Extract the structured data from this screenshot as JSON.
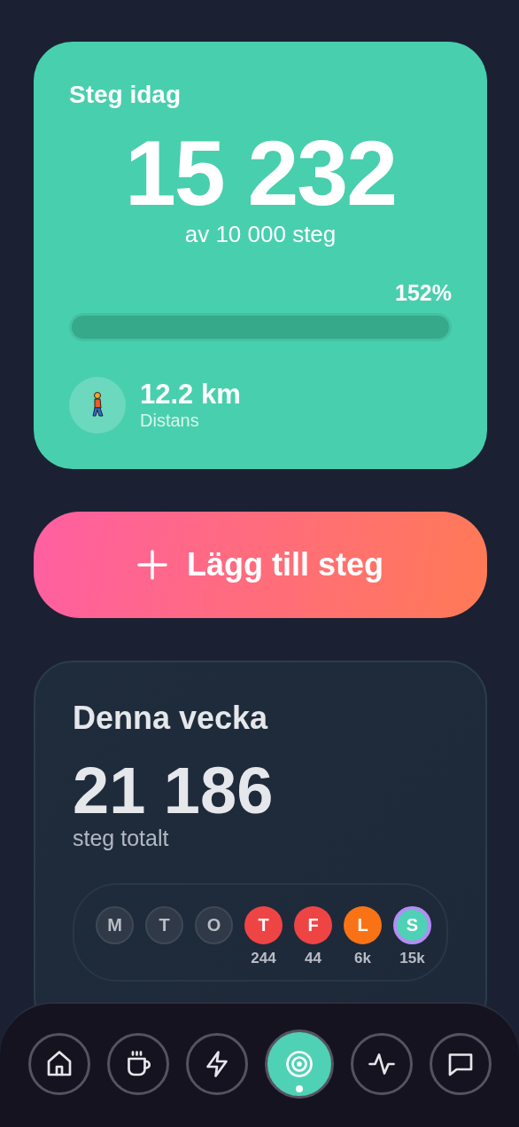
{
  "today_card": {
    "title": "Steg idag",
    "steps": "15 232",
    "goal": "av 10 000 steg",
    "percent": "152%",
    "level": 1,
    "distance": "12.2 km",
    "distance_label": "Distans"
  },
  "add_button": {
    "label": "Lägg till steg"
  },
  "week_card": {
    "title": "Denna vecka",
    "total": "21 186",
    "total_label": "steg totalt",
    "days": [
      {
        "letter": "M",
        "today": false
      },
      {
        "letter": "T",
        "today": false
      },
      {
        "letter": "O",
        "today": false
      },
      {
        "letter": "T",
        "count": "244",
        "color": "#ef4444",
        "today": false
      },
      {
        "letter": "F",
        "count": "44",
        "color": "#ef4444",
        "today": false
      },
      {
        "letter": "L",
        "count": "6k",
        "color": "#f97316",
        "today": false
      },
      {
        "letter": "S",
        "count": "15k",
        "color": "#4fd1b5",
        "today": true
      }
    ]
  },
  "nav": [
    {
      "selected": false
    },
    {
      "selected": false
    },
    {
      "selected": false
    },
    {
      "selected": true
    },
    {
      "selected": false
    },
    {
      "selected": false
    }
  ]
}
